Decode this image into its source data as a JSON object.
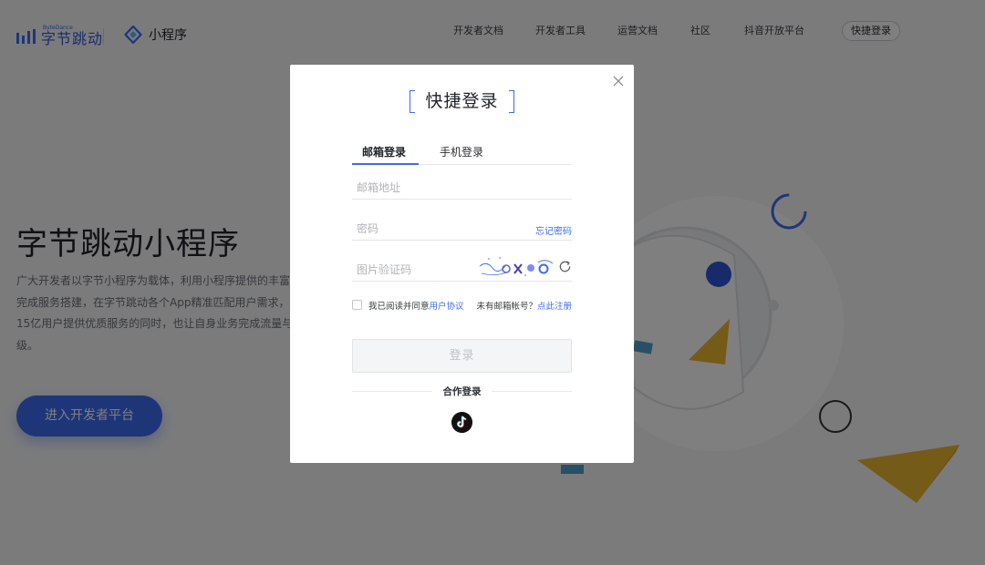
{
  "nav": {
    "brand_en": "ByteDance",
    "brand_cn": "字节跳动",
    "product": "小程序",
    "links": [
      "开发者文档",
      "开发者工具",
      "运营文档",
      "社区",
      "抖音开放平台"
    ],
    "login": "快捷登录"
  },
  "hero": {
    "title": "字节跳动小程序",
    "desc": [
      "广大开发者以字节小程序为载体，利用小程序提供的丰富",
      "完成服务搭建，在字节跳动各个App精准匹配用户需求，",
      "15亿用户提供优质服务的同时，也让自身业务完成流量与",
      "级。"
    ],
    "cta": "进入开发者平台"
  },
  "modal": {
    "title": "快捷登录",
    "tabs": [
      "邮箱登录",
      "手机登录"
    ],
    "email_placeholder": "邮箱地址",
    "password_placeholder": "密码",
    "forgot": "忘记密码",
    "captcha_placeholder": "图片验证码",
    "agree_prefix": "我已阅读并同意",
    "agree_link": "用户协议",
    "signup_prefix": "未有邮箱帐号？",
    "signup_link": "点此注册",
    "login_button": "登录",
    "partner_label": "合作登录"
  },
  "colors": {
    "accent": "#3c6cf0",
    "overlay": "rgba(0,0,0,0.5)"
  }
}
